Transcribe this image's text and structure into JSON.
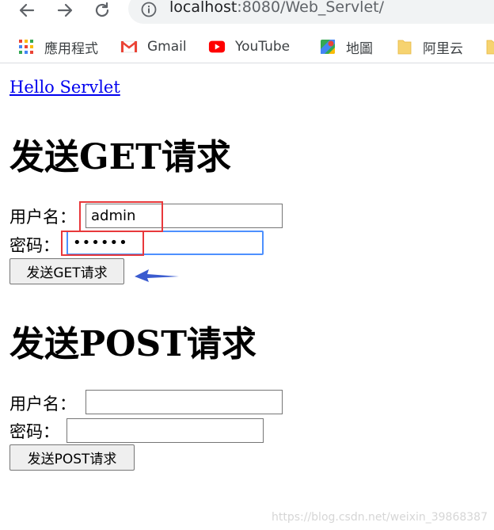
{
  "browser": {
    "address_host": "localhost",
    "address_path": ":8080/Web_Servlet/",
    "bookmarks": [
      {
        "label": "應用程式",
        "icon": "apps-grid-icon"
      },
      {
        "label": "Gmail",
        "icon": "gmail-icon"
      },
      {
        "label": "YouTube",
        "icon": "youtube-icon"
      },
      {
        "label": "地圖",
        "icon": "maps-icon"
      },
      {
        "label": "阿里云",
        "icon": "folder-icon"
      }
    ]
  },
  "page": {
    "hello_link": "Hello Servlet",
    "get_section": {
      "title": "发送GET请求",
      "username_label": "用户名：",
      "username_value": "admin",
      "password_label": "密码：",
      "password_value": "••••••",
      "submit_label": "发送GET请求"
    },
    "post_section": {
      "title": "发送POST请求",
      "username_label": "用户名：",
      "username_value": "",
      "password_label": "密码：",
      "password_value": "",
      "submit_label": "发送POST请求"
    }
  },
  "watermark": "https://blog.csdn.net/weixin_39868387",
  "colors": {
    "link": "#0000ee",
    "highlight_box": "#e8383b",
    "arrow": "#3a5bcf",
    "focus_ring": "#4d90fe"
  }
}
